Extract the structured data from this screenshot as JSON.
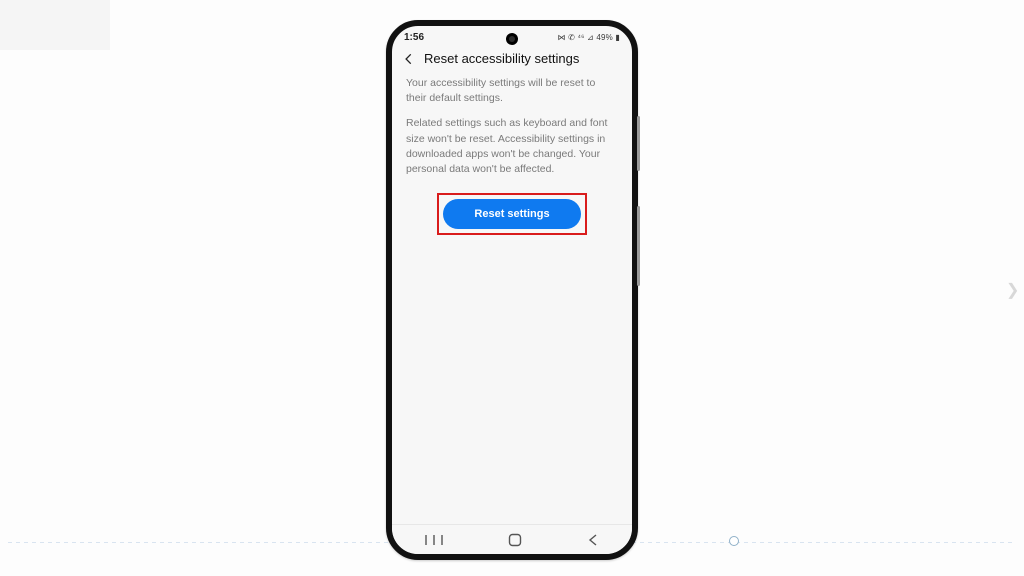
{
  "status_bar": {
    "time": "1:56",
    "indicators": "⋈ ✆ ⁴⁶ ⊿ 49% ▮"
  },
  "header": {
    "title": "Reset accessibility settings"
  },
  "body": {
    "paragraph1": "Your accessibility settings will be reset to their default settings.",
    "paragraph2": "Related settings such as keyboard and font size won't be reset. Accessibility settings in downloaded apps won't be changed. Your personal data won't be affected."
  },
  "button": {
    "reset_label": "Reset settings"
  },
  "colors": {
    "button_bg": "#0f7af0",
    "highlight_border": "#d91c1c"
  }
}
